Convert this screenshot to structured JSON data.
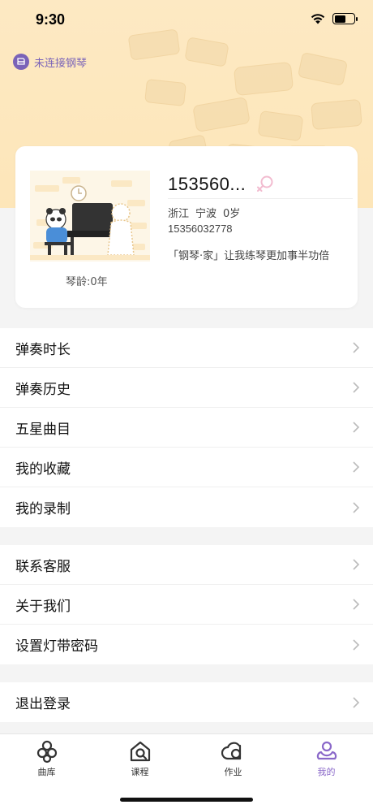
{
  "status_bar": {
    "time": "9:30"
  },
  "piano": {
    "status_label": "未连接钢琴",
    "icon": "piano-icon"
  },
  "profile": {
    "name": "153560...",
    "gender_icon": "female-icon",
    "province": "浙江",
    "city": "宁波",
    "age": "0岁",
    "phone": "15356032778",
    "slogan": "「钢琴·家」让我练琴更加事半功倍",
    "piano_age": "琴龄:0年"
  },
  "menu_group_1": [
    {
      "label": "弹奏时长"
    },
    {
      "label": "弹奏历史"
    },
    {
      "label": "五星曲目"
    },
    {
      "label": "我的收藏"
    },
    {
      "label": "我的录制"
    }
  ],
  "menu_group_2": [
    {
      "label": "联系客服"
    },
    {
      "label": "关于我们"
    },
    {
      "label": "设置灯带密码"
    }
  ],
  "menu_group_3": [
    {
      "label": "退出登录"
    }
  ],
  "tabs": [
    {
      "label": "曲库",
      "icon": "library-icon"
    },
    {
      "label": "课程",
      "icon": "course-icon"
    },
    {
      "label": "作业",
      "icon": "homework-icon"
    },
    {
      "label": "我的",
      "icon": "profile-icon",
      "active": true
    }
  ],
  "colors": {
    "accent": "#8a68c9",
    "header_bg": "#fde9c3",
    "piano_status": "#7a63b8"
  }
}
